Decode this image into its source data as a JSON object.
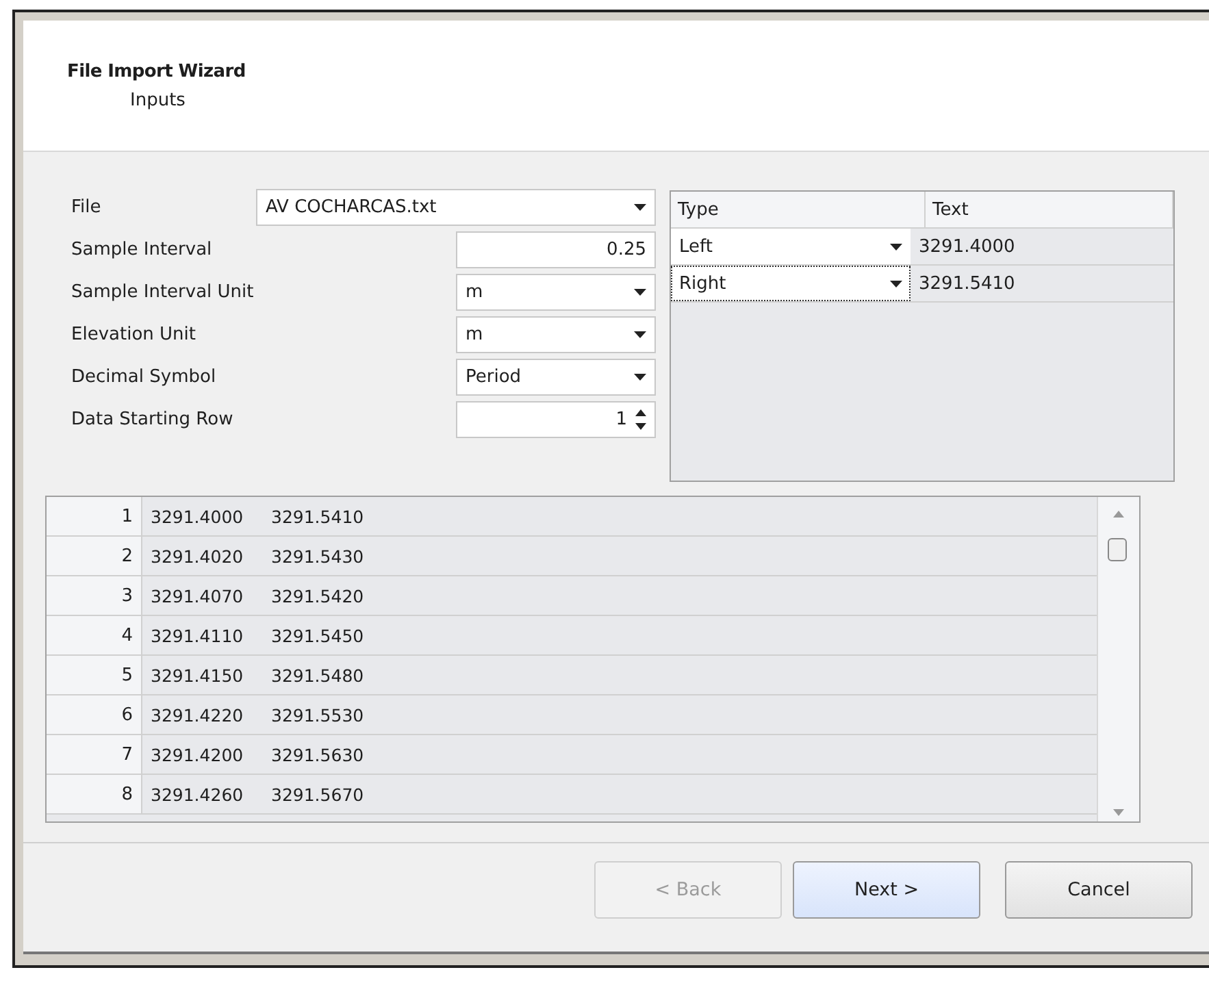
{
  "window": {
    "title": "File Import Wizard",
    "subtitle": "Inputs"
  },
  "fields": [
    {
      "label": "File",
      "kind": "dropdown",
      "value": "AV COCHARCAS.txt",
      "wide": true
    },
    {
      "label": "Sample Interval",
      "kind": "number",
      "value": "0.25",
      "wide": false
    },
    {
      "label": "Sample Interval Unit",
      "kind": "dropdown",
      "value": "m",
      "wide": false
    },
    {
      "label": "Elevation Unit",
      "kind": "dropdown",
      "value": "m",
      "wide": false
    },
    {
      "label": "Decimal Symbol",
      "kind": "dropdown",
      "value": "Period",
      "wide": false
    },
    {
      "label": "Data Starting Row",
      "kind": "spinner",
      "value": "1",
      "wide": false
    }
  ],
  "column_grid": {
    "columns": [
      "Type",
      "Text"
    ],
    "rows": [
      {
        "type": "Left",
        "text": "3291.4000",
        "focused": false
      },
      {
        "type": "Right",
        "text": "3291.5410",
        "focused": true
      }
    ]
  },
  "preview": {
    "rows": [
      {
        "number": "1",
        "values": [
          "3291.4000",
          "3291.5410"
        ]
      },
      {
        "number": "2",
        "values": [
          "3291.4020",
          "3291.5430"
        ]
      },
      {
        "number": "3",
        "values": [
          "3291.4070",
          "3291.5420"
        ]
      },
      {
        "number": "4",
        "values": [
          "3291.4110",
          "3291.5450"
        ]
      },
      {
        "number": "5",
        "values": [
          "3291.4150",
          "3291.5480"
        ]
      },
      {
        "number": "6",
        "values": [
          "3291.4220",
          "3291.5530"
        ]
      },
      {
        "number": "7",
        "values": [
          "3291.4200",
          "3291.5630"
        ]
      },
      {
        "number": "8",
        "values": [
          "3291.4260",
          "3291.5670"
        ]
      }
    ]
  },
  "buttons": [
    {
      "label": "< Back",
      "disabled": true,
      "default": false
    },
    {
      "label": "Next >",
      "disabled": false,
      "default": true
    },
    {
      "label": "Cancel",
      "disabled": false,
      "default": false
    }
  ]
}
